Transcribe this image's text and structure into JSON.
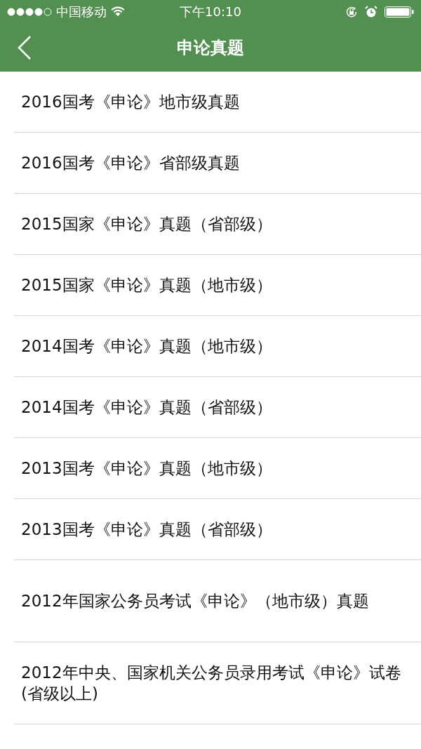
{
  "status_bar": {
    "carrier": "中国移动",
    "time": "下午10:10"
  },
  "nav_bar": {
    "title": "申论真题"
  },
  "items": [
    {
      "label": "2016国考《申论》地市级真题",
      "kind": "short"
    },
    {
      "label": "2016国考《申论》省部级真题",
      "kind": "short"
    },
    {
      "label": "2015国家《申论》真题（省部级）",
      "kind": "short"
    },
    {
      "label": "2015国家《申论》真题（地市级）",
      "kind": "short"
    },
    {
      "label": "2014国考《申论》真题（地市级）",
      "kind": "short"
    },
    {
      "label": "2014国考《申论》真题（省部级）",
      "kind": "short"
    },
    {
      "label": "2013国考《申论》真题（地市级）",
      "kind": "short"
    },
    {
      "label": "2013国考《申论》真题（省部级）",
      "kind": "short"
    },
    {
      "label": "2012年国家公务员考试《申论》（地市级）真题",
      "kind": "tall"
    },
    {
      "label": "2012年中央、国家机关公务员录用考试《申论》试卷(省级以上)",
      "kind": "tall"
    }
  ]
}
